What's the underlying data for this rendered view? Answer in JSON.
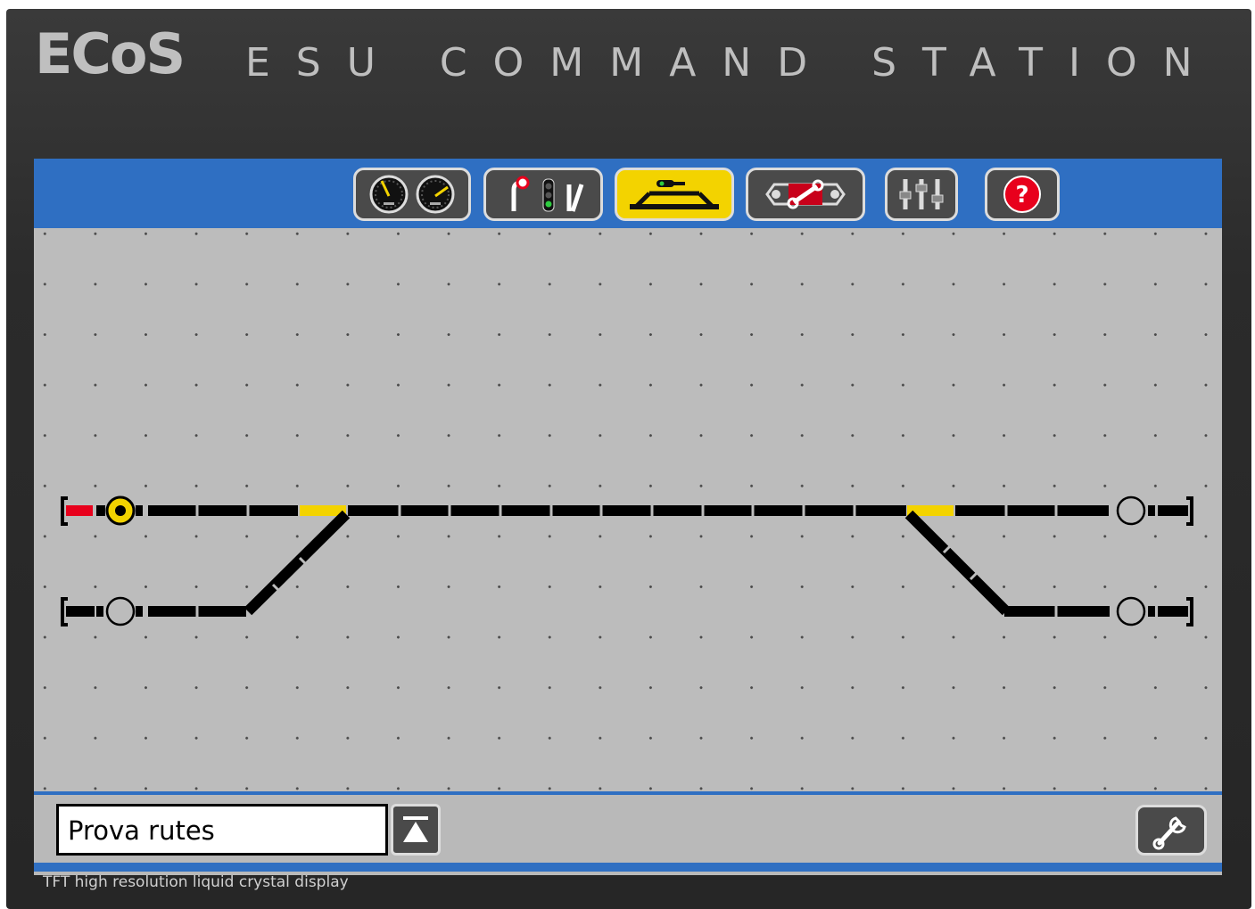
{
  "header": {
    "brand": "ECoS",
    "subtitle": "ESU COMMAND STATION"
  },
  "footer": {
    "caption": "TFT high resolution liquid crystal display"
  },
  "toolbar": {
    "buttons": [
      {
        "name": "locomotive-control",
        "icon": "speedometer-icon",
        "active": false
      },
      {
        "name": "accessories",
        "icon": "signals-icon",
        "active": false
      },
      {
        "name": "track-layout",
        "icon": "track-layout-icon",
        "active": true
      },
      {
        "name": "programming",
        "icon": "programming-icon",
        "active": false
      },
      {
        "name": "setup",
        "icon": "sliders-icon",
        "active": false
      },
      {
        "name": "help",
        "icon": "help-icon",
        "active": false
      }
    ],
    "help_glyph": "?"
  },
  "layout_panel": {
    "name": "Prova rutes"
  },
  "colors": {
    "frame": "#2b2b2b",
    "accent_blue": "#2f6fc2",
    "screen_gray": "#b9b9b9",
    "active_yellow": "#f3d300",
    "route_yellow": "#f3d300",
    "occupied_red": "#e8001c",
    "track_black": "#000000"
  }
}
